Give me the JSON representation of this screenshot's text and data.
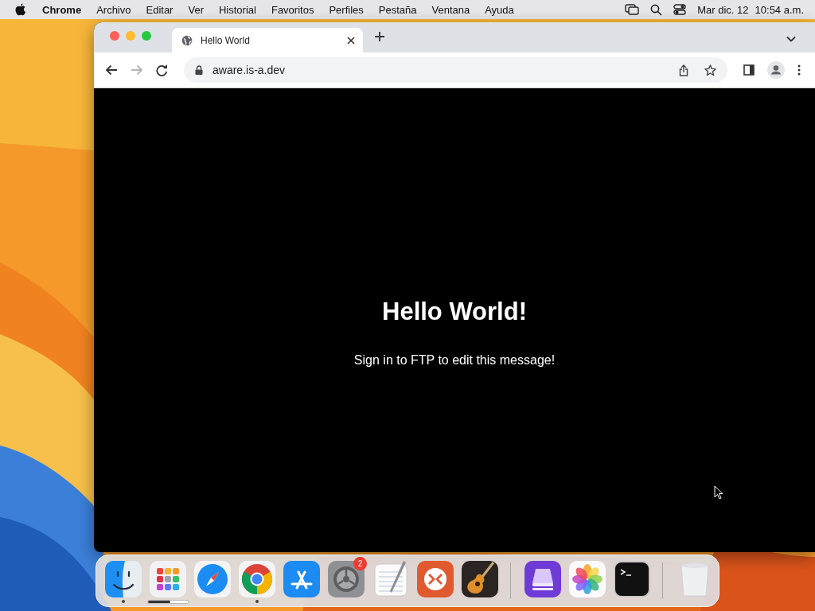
{
  "menu_bar": {
    "app": "Chrome",
    "menus": [
      "Archivo",
      "Editar",
      "Ver",
      "Historial",
      "Favoritos",
      "Perfiles",
      "Pestaña",
      "Ventana",
      "Ayuda"
    ],
    "date": "Mar dic. 12",
    "time": "10:54 a.m."
  },
  "browser": {
    "tabs": [
      {
        "title": "Hello World",
        "selected": true
      }
    ],
    "address": "aware.is-a.dev",
    "page": {
      "heading": "Hello World!",
      "message": "Sign in to FTP to edit this message!"
    }
  },
  "dock": {
    "items": [
      {
        "kind": "finder",
        "running": true
      },
      {
        "kind": "launchpad",
        "running": false,
        "level": 0.55
      },
      {
        "kind": "safari",
        "running": false
      },
      {
        "kind": "chrome",
        "running": true
      },
      {
        "kind": "appstore",
        "running": false
      },
      {
        "kind": "settings",
        "running": false,
        "badge": "2"
      },
      {
        "kind": "textedit",
        "running": false
      },
      {
        "kind": "remote",
        "running": false
      },
      {
        "kind": "guitar",
        "running": false
      },
      {
        "kind": "separator"
      },
      {
        "kind": "configurator",
        "running": false
      },
      {
        "kind": "photos",
        "running": false
      },
      {
        "kind": "terminal",
        "running": false
      },
      {
        "kind": "separator"
      },
      {
        "kind": "trash",
        "running": false
      }
    ]
  }
}
